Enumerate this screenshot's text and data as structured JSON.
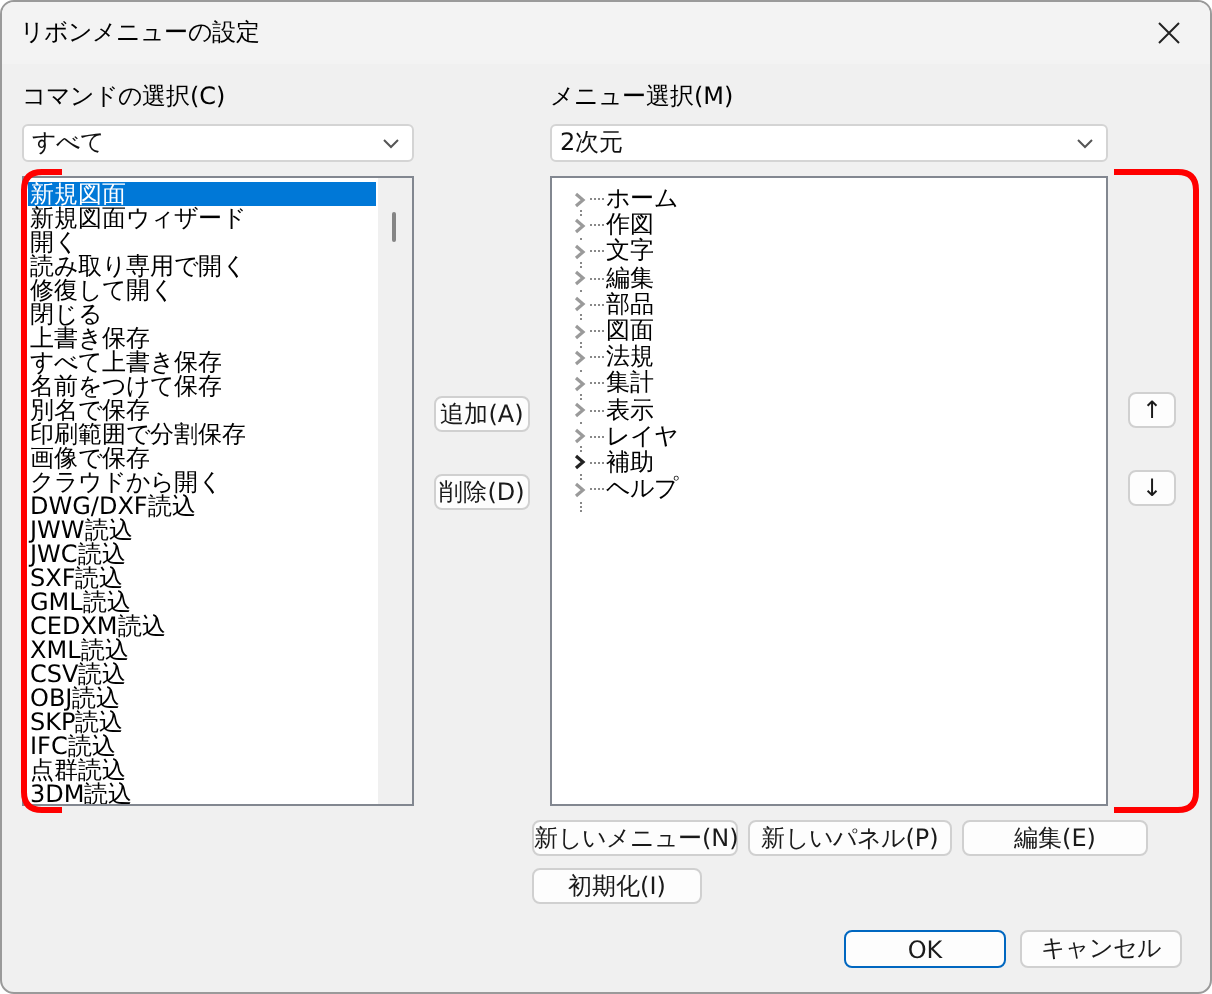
{
  "window": {
    "title": "リボンメニューの設定"
  },
  "command_panel": {
    "label": "コマンドの選択(C)",
    "filter": "すべて",
    "highlighted": true,
    "items": [
      {
        "label": "新規図面",
        "selected": true
      },
      {
        "label": "新規図面ウィザード",
        "selected": false
      },
      {
        "label": "開く",
        "selected": false
      },
      {
        "label": "読み取り専用で開く",
        "selected": false
      },
      {
        "label": "修復して開く",
        "selected": false
      },
      {
        "label": "閉じる",
        "selected": false
      },
      {
        "label": "上書き保存",
        "selected": false
      },
      {
        "label": "すべて上書き保存",
        "selected": false
      },
      {
        "label": "名前をつけて保存",
        "selected": false
      },
      {
        "label": "別名で保存",
        "selected": false
      },
      {
        "label": "印刷範囲で分割保存",
        "selected": false
      },
      {
        "label": "画像で保存",
        "selected": false
      },
      {
        "label": "クラウドから開く",
        "selected": false
      },
      {
        "label": "DWG/DXF読込",
        "selected": false
      },
      {
        "label": "JWW読込",
        "selected": false
      },
      {
        "label": "JWC読込",
        "selected": false
      },
      {
        "label": "SXF読込",
        "selected": false
      },
      {
        "label": "GML読込",
        "selected": false
      },
      {
        "label": "CEDXM読込",
        "selected": false
      },
      {
        "label": "XML読込",
        "selected": false
      },
      {
        "label": "CSV読込",
        "selected": false
      },
      {
        "label": "OBJ読込",
        "selected": false
      },
      {
        "label": "SKP読込",
        "selected": false
      },
      {
        "label": "IFC読込",
        "selected": false
      },
      {
        "label": "点群読込",
        "selected": false
      },
      {
        "label": "3DM読込",
        "selected": false
      }
    ]
  },
  "transfer_buttons": [
    "追加(A)",
    "削除(D)"
  ],
  "menu_panel": {
    "label": "メニュー選択(M)",
    "filter": "2次元",
    "highlighted": true,
    "tree": [
      {
        "label": "ホーム",
        "expanded": false,
        "hovered": false
      },
      {
        "label": "作図",
        "expanded": false,
        "hovered": false
      },
      {
        "label": "文字",
        "expanded": false,
        "hovered": false
      },
      {
        "label": "編集",
        "expanded": false,
        "hovered": false
      },
      {
        "label": "部品",
        "expanded": false,
        "hovered": false
      },
      {
        "label": "図面",
        "expanded": false,
        "hovered": false
      },
      {
        "label": "法規",
        "expanded": false,
        "hovered": false
      },
      {
        "label": "集計",
        "expanded": false,
        "hovered": false
      },
      {
        "label": "表示",
        "expanded": false,
        "hovered": false
      },
      {
        "label": "レイヤ",
        "expanded": false,
        "hovered": false
      },
      {
        "label": "補助",
        "expanded": false,
        "hovered": true
      },
      {
        "label": "ヘルプ",
        "expanded": false,
        "hovered": false
      }
    ]
  },
  "move_buttons": [
    "↑",
    "↓"
  ],
  "menu_buttons": [
    "新しいメニュー(N)",
    "新しいパネル(P)",
    "編集(E)",
    "初期化(I)"
  ],
  "dialog_buttons": [
    {
      "label": "OK",
      "default": true
    },
    {
      "label": "キャンセル",
      "default": false
    }
  ]
}
